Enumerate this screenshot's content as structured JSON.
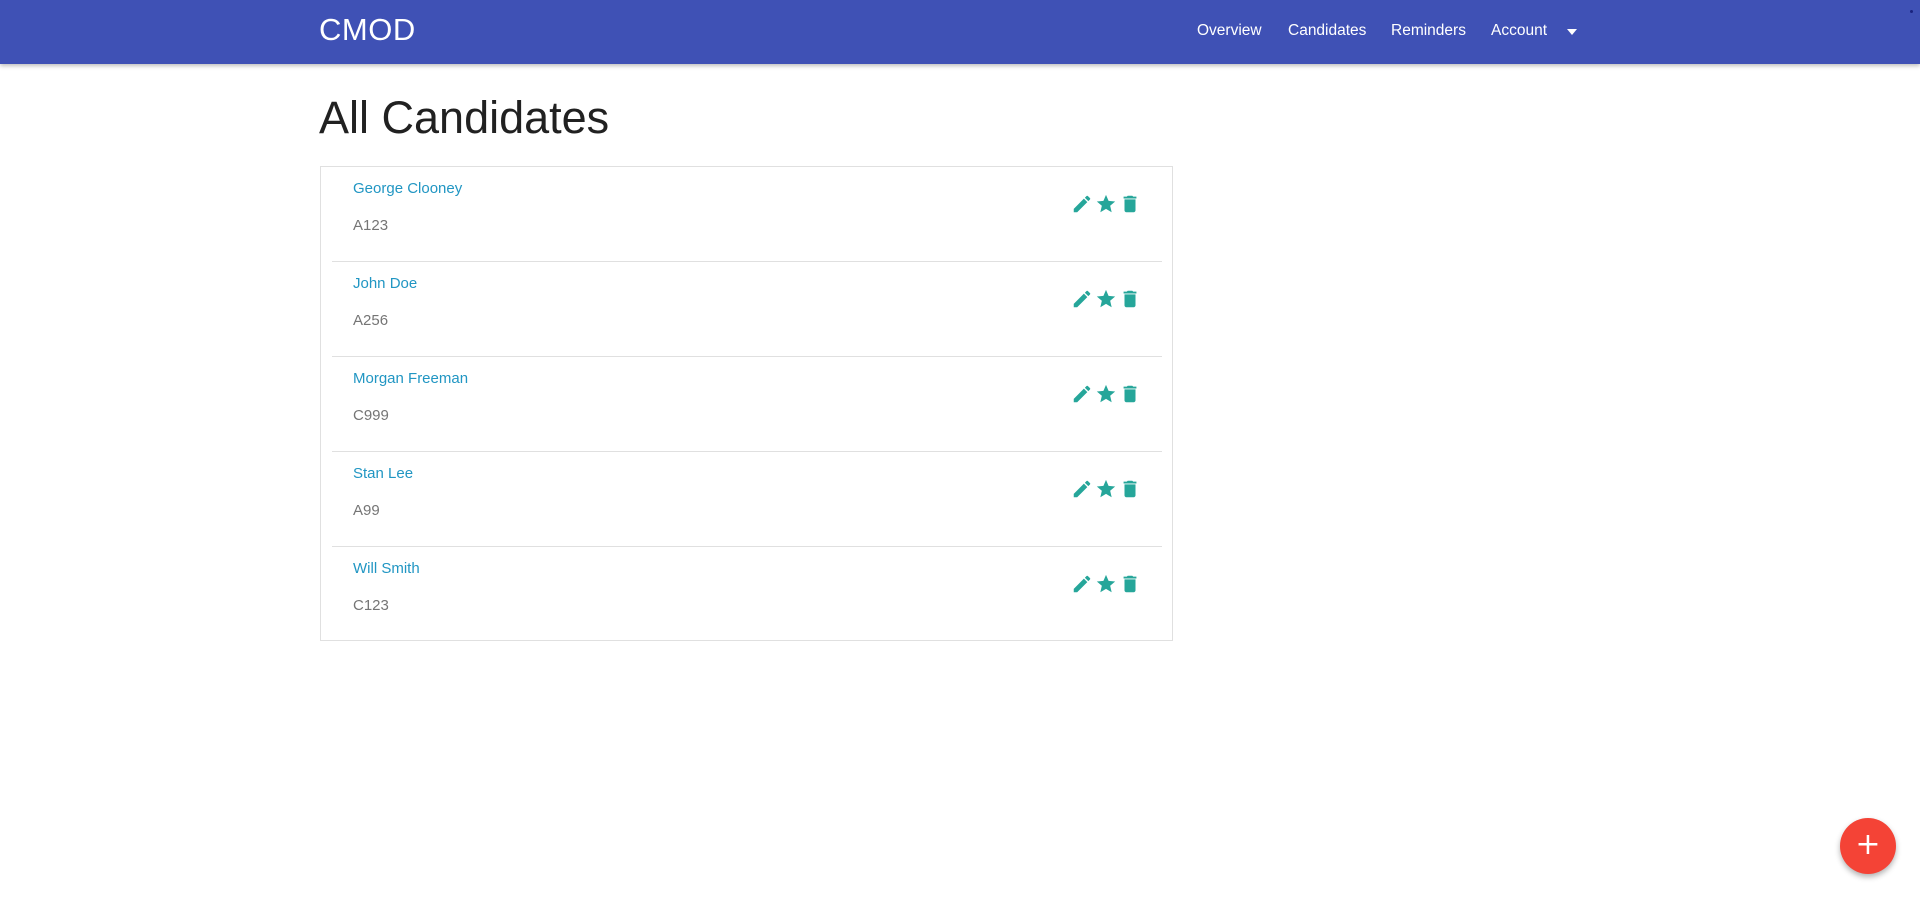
{
  "app": {
    "brand": "CMOD"
  },
  "nav": {
    "items": [
      {
        "label": "Overview"
      },
      {
        "label": "Candidates"
      },
      {
        "label": "Reminders"
      },
      {
        "label": "Account"
      }
    ],
    "dropdown_icon": "caret-down-icon"
  },
  "page": {
    "title": "All Candidates"
  },
  "candidates": [
    {
      "name": "George Clooney",
      "code": "A123"
    },
    {
      "name": "John Doe",
      "code": "A256"
    },
    {
      "name": "Morgan Freeman",
      "code": "C999"
    },
    {
      "name": "Stan Lee",
      "code": "A99"
    },
    {
      "name": "Will Smith",
      "code": "C123"
    }
  ],
  "row_actions": {
    "icons": [
      "edit-icon",
      "star-icon",
      "delete-icon"
    ],
    "color": "#26a69a"
  },
  "fab": {
    "label": "+",
    "icon": "add-icon",
    "color": "#f44336"
  },
  "colors": {
    "navbar": "#3f51b5",
    "link": "#2196c3",
    "secondary_text": "#757575"
  }
}
